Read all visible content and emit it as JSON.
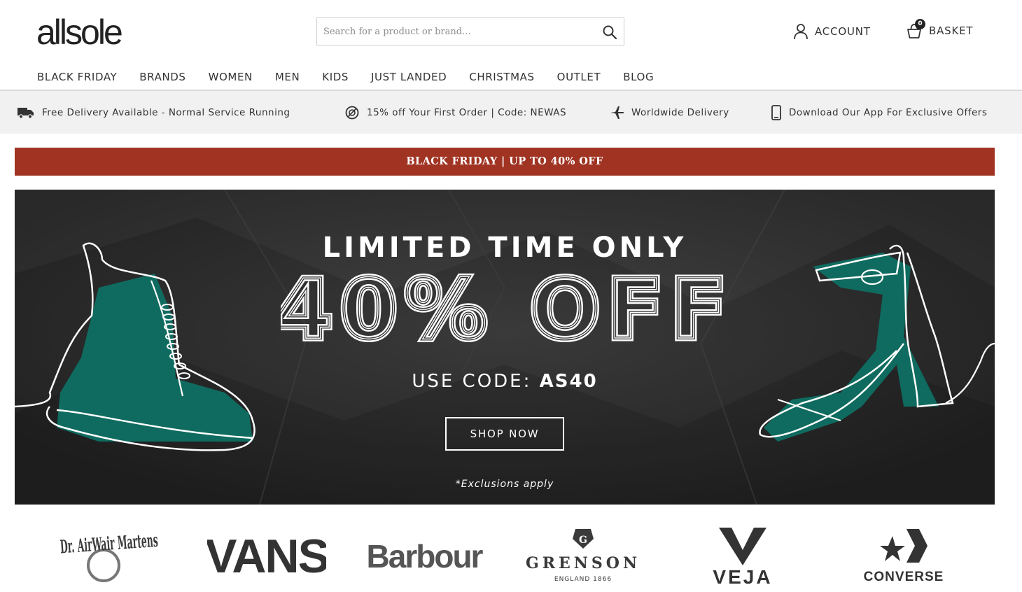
{
  "header": {
    "logo_text": "allsole",
    "search_placeholder": "Search for a product or brand...",
    "account_label": "ACCOUNT",
    "basket_label": "BASKET",
    "basket_count": "0"
  },
  "nav": {
    "items": [
      {
        "label": "BLACK FRIDAY"
      },
      {
        "label": "BRANDS"
      },
      {
        "label": "WOMEN"
      },
      {
        "label": "MEN"
      },
      {
        "label": "KIDS"
      },
      {
        "label": "JUST LANDED"
      },
      {
        "label": "CHRISTMAS"
      },
      {
        "label": "OUTLET"
      },
      {
        "label": "BLOG"
      }
    ]
  },
  "usp": {
    "items": [
      {
        "icon": "delivery-truck-icon",
        "text": "Free Delivery Available - Normal Service Running"
      },
      {
        "icon": "discount-tag-icon",
        "text": "15% off Your First Order | Code: NEWAS"
      },
      {
        "icon": "airplane-icon",
        "text": "Worldwide Delivery"
      },
      {
        "icon": "mobile-phone-icon",
        "text": "Download Our App For Exclusive Offers"
      }
    ]
  },
  "promo_strip": {
    "text": "BLACK FRIDAY | UP TO 40% OFF",
    "background": "#a03322"
  },
  "hero": {
    "headline": "LIMITED TIME ONLY",
    "offer": "40% OFF",
    "code_prefix": "USE CODE: ",
    "code": "AS40",
    "cta": "SHOP NOW",
    "disclaimer": "*Exclusions apply",
    "accent_color": "#0f6b5f"
  },
  "brands": [
    {
      "name": "Dr. AirWair Martens"
    },
    {
      "name": "VANS"
    },
    {
      "name": "Barbour"
    },
    {
      "name": "GRENSON"
    },
    {
      "name": "ENGLAND 1866"
    },
    {
      "name": "VEJA"
    },
    {
      "name": "CONVERSE"
    }
  ]
}
